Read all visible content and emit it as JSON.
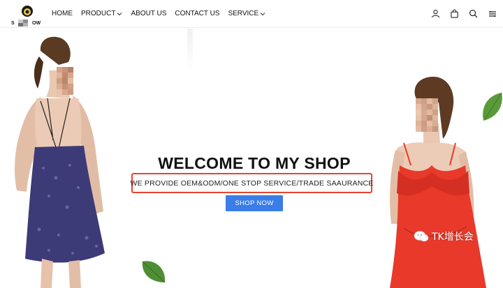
{
  "header": {
    "logo": {
      "left_text": "S",
      "right_text": "OW"
    },
    "nav": [
      {
        "label": "HOME",
        "has_dropdown": false
      },
      {
        "label": "PRODUCT",
        "has_dropdown": true
      },
      {
        "label": "ABOUT US",
        "has_dropdown": false
      },
      {
        "label": "CONTACT US",
        "has_dropdown": false
      },
      {
        "label": "SERVICE",
        "has_dropdown": true
      }
    ],
    "tools": [
      "user-icon",
      "bag-icon",
      "search-icon",
      "menu-icon"
    ]
  },
  "hero": {
    "title": "WELCOME TO MY SHOP",
    "subtitle": "WE PROVIDE OEM&ODM/ONE STOP SERVICE/TRADE SAAURANCE",
    "cta_label": "SHOP NOW"
  },
  "watermark": {
    "text": "TK增长会"
  },
  "colors": {
    "cta": "#3a7de8",
    "highlight_border": "#e8432f",
    "left_dress": "#3d3a78",
    "right_dress": "#e8392b",
    "leaf": "#5a9a3a"
  }
}
